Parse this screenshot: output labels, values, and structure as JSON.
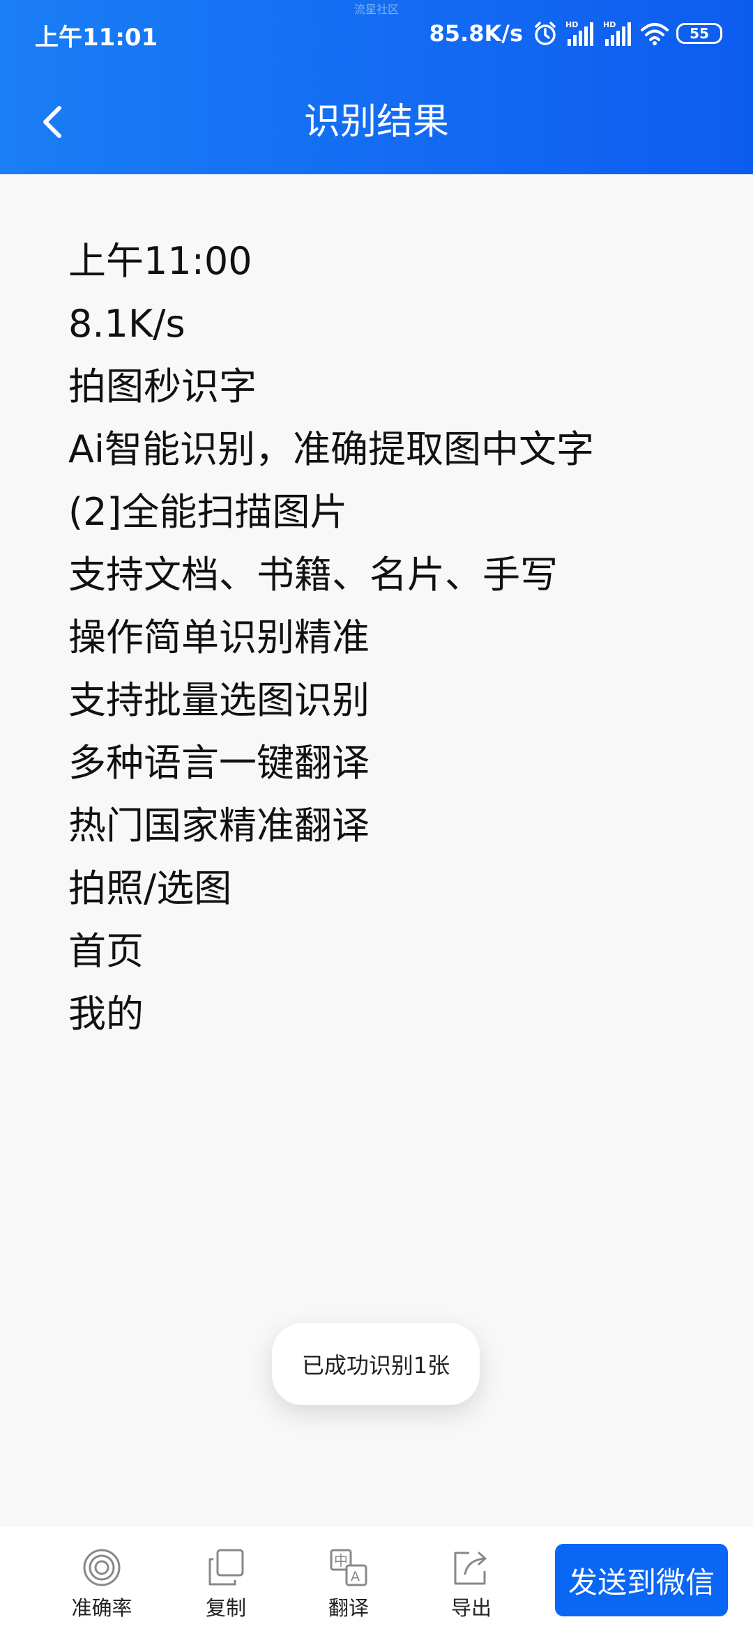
{
  "watermark": "流星社区",
  "status_bar": {
    "time": "上午11:01",
    "net_speed": "85.8K/s",
    "battery": "55",
    "icons": [
      "alarm-icon",
      "hd-signal-icon",
      "hd-signal-icon",
      "wifi-icon",
      "battery-icon"
    ]
  },
  "header": {
    "title": "识别结果",
    "back_icon": "chevron-left-icon",
    "background": "#0d6cf2"
  },
  "result_lines": [
    "上午11:00",
    "8.1K/s",
    "拍图秒识字",
    "Ai智能识别，准确提取图中文字",
    "(2]全能扫描图片",
    "支持文档、书籍、名片、手写",
    "操作简单识别精准",
    "支持批量选图识别",
    "多种语言一键翻译",
    "热门国家精准翻译",
    "拍照/选图",
    "首页",
    "我的"
  ],
  "toast": "已成功识别1张",
  "toolbar": {
    "accuracy_label": "准确率",
    "copy_label": "复制",
    "translate_label": "翻译",
    "export_label": "导出",
    "send_label": "发送到微信",
    "accent": "#0a66f5"
  }
}
